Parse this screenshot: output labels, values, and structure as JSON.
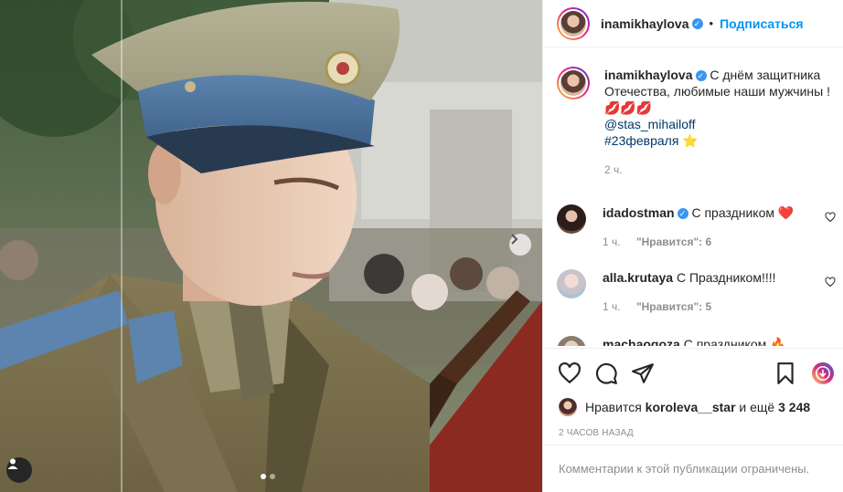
{
  "post": {
    "username": "inamikhaylova",
    "verified_mark": "✓",
    "separator": "•",
    "follow_label": "Подписаться",
    "caption_lines": [
      "С днём защитника",
      "Отечества, любимые наши мужчины !"
    ],
    "caption_emojis": "💋💋💋",
    "mention": "@stas_mihailoff",
    "hashtag": "#23февраля",
    "hashtag_emoji": "⭐",
    "caption_time": "2 ч."
  },
  "comments": [
    {
      "username": "idadostman",
      "verified": true,
      "text": "С праздником",
      "emoji": "❤️",
      "time": "1 ч.",
      "likes": "\"Нравится\": 6"
    },
    {
      "username": "alla.krutaya",
      "verified": false,
      "text": "С Праздником!!!!",
      "emoji": "",
      "time": "1 ч.",
      "likes": "\"Нравится\": 5"
    },
    {
      "username": "machaogoza",
      "verified": false,
      "text": "С праздником",
      "emoji": "🔥",
      "time": "",
      "likes": ""
    }
  ],
  "likes": {
    "prefix": "Нравится",
    "user": "koroleva__star",
    "suffix": "и ещё",
    "count": "3 248"
  },
  "posted_time": "2 часов назад",
  "comments_limited": "Комментарии к этой публикации ограничены.",
  "carousel": {
    "current": 1,
    "total": 2
  },
  "icons": {
    "like": "heart-icon",
    "comment": "comment-icon",
    "share": "share-icon",
    "save": "bookmark-icon",
    "next": "chevron-right-icon",
    "tag": "user-tag-icon",
    "extra": "instagram-gradient-icon"
  },
  "colors": {
    "accent": "#0095f6",
    "verified": "#3897f0",
    "muted": "#8e8e8e",
    "link": "#00376b"
  }
}
